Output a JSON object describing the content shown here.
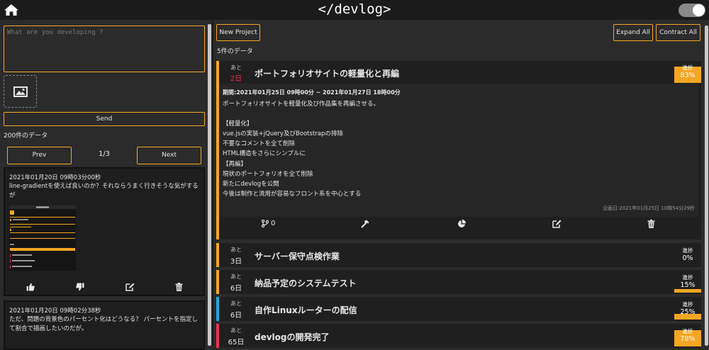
{
  "app": {
    "title": "</devlog>"
  },
  "left": {
    "placeholder": "What are you developing ?",
    "send_label": "Send",
    "count": "200件のデータ",
    "prev_label": "Prev",
    "next_label": "Next",
    "page": "1/3",
    "posts": [
      {
        "date": "2021年01月20日 09時03分00秒",
        "text": "line-gradientを使えば良いのか？それならうまく行きそうな気がするが"
      },
      {
        "date": "2021年01月20日 09時02分38秒",
        "text": "ただ、問題の背景色のパーセント化はどうなる？ パーセントを指定して割合で描画したいのだが。"
      }
    ]
  },
  "right": {
    "new_project": "New Project",
    "expand_all": "Expand All",
    "contract_all": "Contract All",
    "count": "5件のデータ",
    "progress_label": "進捗",
    "remaining_label": "あと",
    "projects": [
      {
        "days": "2日",
        "title": "ポートフォリオサイトの軽量化と再編",
        "progress": "83%",
        "progress_value": 0.83,
        "stripe": "#f5a623",
        "days_color": "#e8344e"
      },
      {
        "days": "3日",
        "title": "サーバー保守点検作業",
        "progress": "0%",
        "progress_value": 0.0,
        "stripe": "#f5a623",
        "days_color": "#c8c8c8"
      },
      {
        "days": "6日",
        "title": "納品予定のシステムテスト",
        "progress": "15%",
        "progress_value": 0.15,
        "stripe": "#f5a623",
        "days_color": "#c8c8c8"
      },
      {
        "days": "6日",
        "title": "自作Linuxルーターの配信",
        "progress": "25%",
        "progress_value": 0.25,
        "stripe": "#1fa8e0",
        "days_color": "#c8c8c8"
      },
      {
        "days": "65日",
        "title": "devlogの開発完了",
        "progress": "78%",
        "progress_value": 0.78,
        "stripe": "#e8344e",
        "days_color": "#c8c8c8"
      }
    ],
    "detail": {
      "period": "期間:2021年01月25日 09時00分 ~ 2021年01月27日 18時00分",
      "description": "ポートフォリオサイトを軽量化及び作品集を再編させる。\n\n【軽量化】\nvue.jsの実装+jQuery及びBootstrapの排除\n不要なコメントを全て削除\nHTML構造をさらにシンプルに\n【再編】\n現状のポートフォリオを全て削除\n新たにdevlogを公開\n今後は制作と流用が容易なフロント系を中心とする",
      "created": "企画日:2021年01月25日 10時54分29秒",
      "branch_count": "0"
    }
  },
  "colors": {
    "accent": "#f5a623",
    "bg": "#2b2b2b",
    "topbar": "#1b1b1b"
  },
  "icons": [
    "home-icon",
    "toggle-switch",
    "image-icon",
    "thumbs-up-icon",
    "thumbs-down-icon",
    "edit-icon",
    "trash-icon",
    "branch-icon",
    "hammer-icon",
    "pie-chart-icon"
  ]
}
